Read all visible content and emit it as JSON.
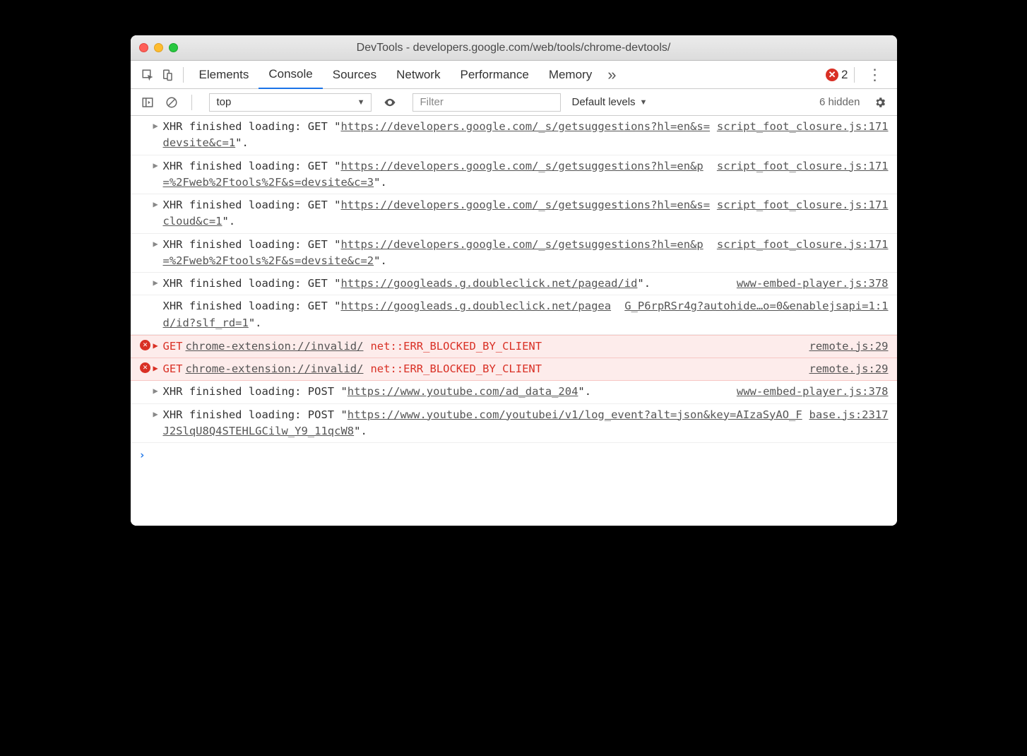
{
  "window": {
    "title": "DevTools - developers.google.com/web/tools/chrome-devtools/"
  },
  "tabs": {
    "items": [
      "Elements",
      "Console",
      "Sources",
      "Network",
      "Performance",
      "Memory"
    ],
    "active": "Console",
    "overflow_glyph": "»",
    "error_count": "2"
  },
  "toolbar": {
    "context": "top",
    "filter_placeholder": "Filter",
    "levels": "Default levels",
    "hidden": "6 hidden"
  },
  "logs": [
    {
      "type": "info",
      "disclosure": true,
      "pre": "XHR finished loading: GET \"",
      "url": "https://developers.google.com/_s/getsuggestions?hl=en&s=devsite&c=1",
      "post": "\".",
      "src": "script_foot_closure.js:171"
    },
    {
      "type": "info",
      "disclosure": true,
      "pre": "XHR finished loading: GET \"",
      "url": "https://developers.google.com/_s/getsuggestions?hl=en&p=%2Fweb%2Ftools%2F&s=devsite&c=3",
      "post": "\".",
      "src": "script_foot_closure.js:171"
    },
    {
      "type": "info",
      "disclosure": true,
      "pre": "XHR finished loading: GET \"",
      "url": "https://developers.google.com/_s/getsuggestions?hl=en&s=cloud&c=1",
      "post": "\".",
      "src": "script_foot_closure.js:171"
    },
    {
      "type": "info",
      "disclosure": true,
      "pre": "XHR finished loading: GET \"",
      "url": "https://developers.google.com/_s/getsuggestions?hl=en&p=%2Fweb%2Ftools%2F&s=devsite&c=2",
      "post": "\".",
      "src": "script_foot_closure.js:171"
    },
    {
      "type": "info",
      "disclosure": true,
      "pre": "XHR finished loading: GET \"",
      "url": "https://googleads.g.doubleclick.net/pagead/id",
      "post": "\".",
      "src": "www-embed-player.js:378"
    },
    {
      "type": "info",
      "disclosure": false,
      "pre": "XHR finished loading: GET \"",
      "url": "https://googleads.g.doubleclick.net/pagead/id?slf_rd=1",
      "post": "\".",
      "src": "G_P6rpRSr4g?autohide…o=0&enablejsapi=1:1"
    },
    {
      "type": "error",
      "disclosure": true,
      "method": "GET",
      "url": "chrome-extension://invalid/",
      "status": "net::ERR_BLOCKED_BY_CLIENT",
      "src": "remote.js:29"
    },
    {
      "type": "error",
      "disclosure": true,
      "method": "GET",
      "url": "chrome-extension://invalid/",
      "status": "net::ERR_BLOCKED_BY_CLIENT",
      "src": "remote.js:29"
    },
    {
      "type": "info",
      "disclosure": true,
      "pre": "XHR finished loading: POST \"",
      "url": "https://www.youtube.com/ad_data_204",
      "post": "\".",
      "src": "www-embed-player.js:378"
    },
    {
      "type": "info",
      "disclosure": true,
      "pre": "XHR finished loading: POST \"",
      "url": "https://www.youtube.com/youtubei/v1/log_event?alt=json&key=AIzaSyAO_FJ2SlqU8Q4STEHLGCilw_Y9_11qcW8",
      "post": "\".",
      "src": "base.js:2317"
    }
  ],
  "prompt": "›"
}
